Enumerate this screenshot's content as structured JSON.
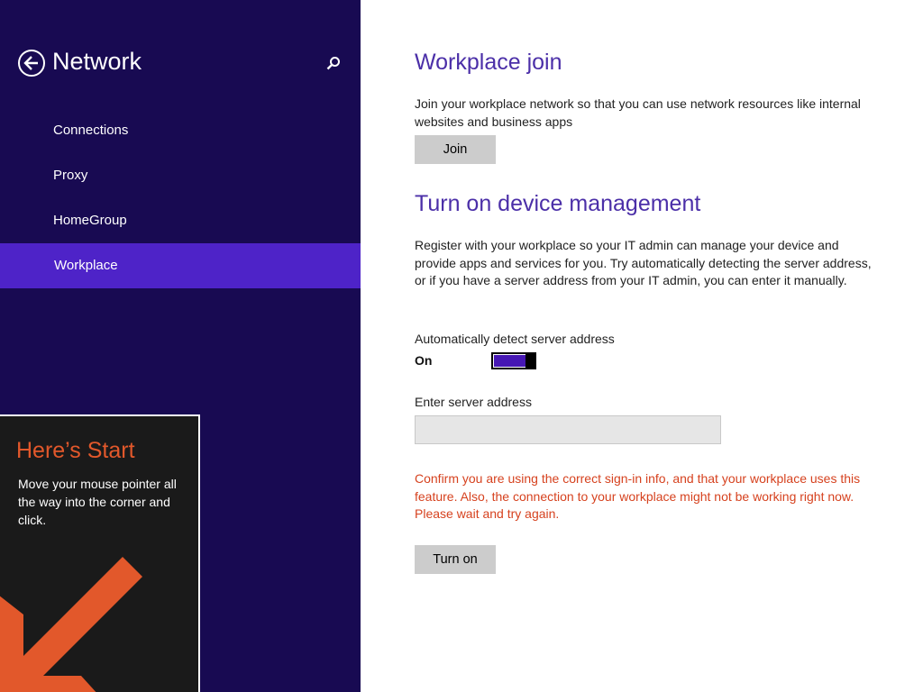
{
  "nav": {
    "title": "Network",
    "back_icon": "back-arrow-circle-icon",
    "search_icon": "magnifier-icon",
    "items": [
      {
        "label": "Connections",
        "selected": false
      },
      {
        "label": "Proxy",
        "selected": false
      },
      {
        "label": "HomeGroup",
        "selected": false
      },
      {
        "label": "Workplace",
        "selected": true
      }
    ],
    "colors": {
      "background": "#180a52",
      "selected": "#4e23c8"
    }
  },
  "tip": {
    "title": "Here’s Start",
    "body": "Move your mouse pointer all the way into the corner and click.",
    "arrow_icon": "corner-arrow-icon",
    "colors": {
      "title": "#e2582b",
      "arrow": "#e2582b",
      "background": "#1a1a1a"
    }
  },
  "workplace_join": {
    "heading": "Workplace join",
    "description": "Join your workplace network so that you can use network resources like internal websites and business apps",
    "join_label": "Join"
  },
  "device_management": {
    "heading": "Turn on device management",
    "description": "Register with your workplace so your IT admin can manage your device and provide apps and services for you. Try automatically detecting the server address, or if you have a server address from your IT admin, you can enter it manually.",
    "auto_detect_label": "Automatically detect server address",
    "toggle_state": "On",
    "toggle_on": true,
    "server_address_label": "Enter server address",
    "server_address_value": "",
    "server_address_placeholder": "",
    "error_message": "Confirm you are using the correct sign-in info, and that your workplace uses this feature. Also, the connection to your workplace might not be working right now. Please wait and try again.",
    "turn_on_label": "Turn on"
  },
  "colors": {
    "heading": "#4b2fa8",
    "error": "#d6421f",
    "toggle": "#4617b4",
    "button": "#cccccc"
  }
}
